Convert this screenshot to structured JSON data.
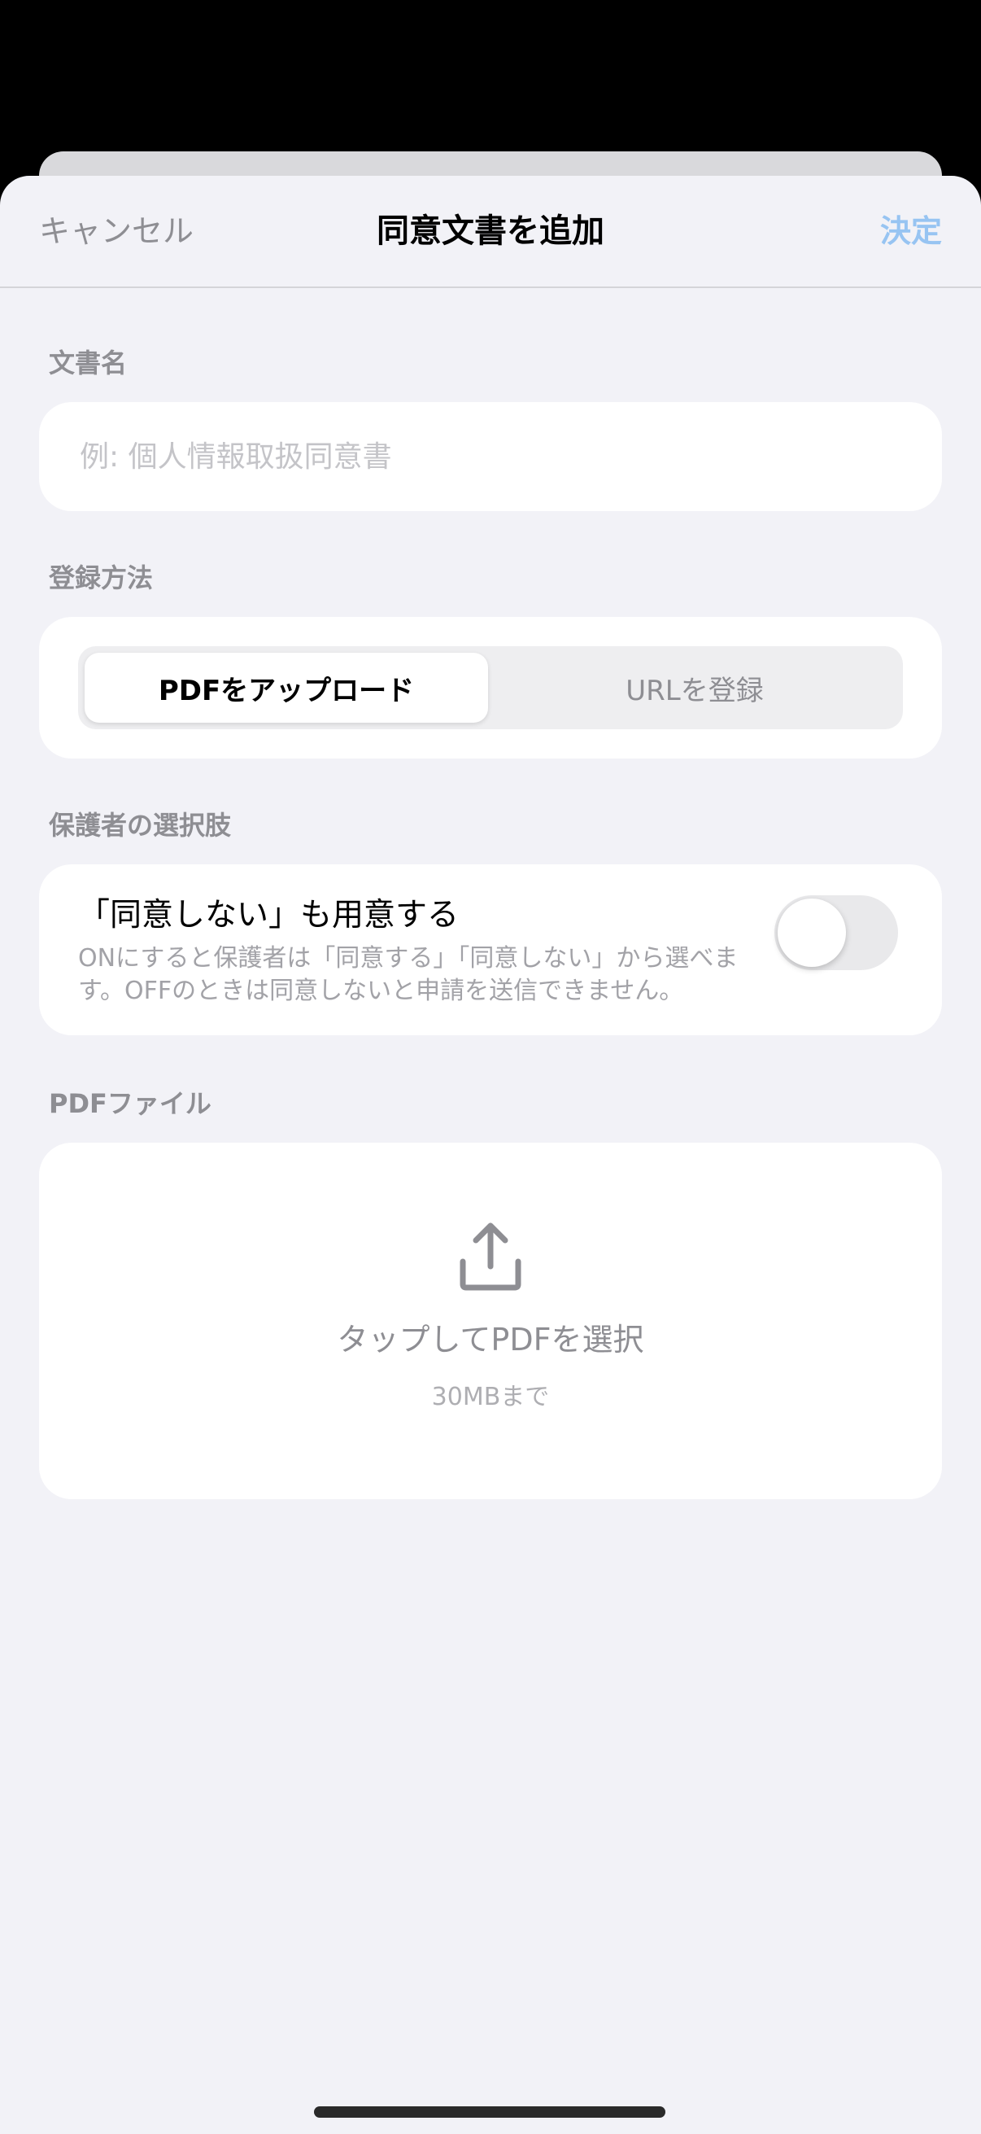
{
  "nav": {
    "cancel_label": "キャンセル",
    "title": "同意文書を追加",
    "done_label": "決定"
  },
  "document_name": {
    "section_label": "文書名",
    "placeholder": "例: 個人情報取扱同意書",
    "value": ""
  },
  "registration_method": {
    "section_label": "登録方法",
    "options": [
      {
        "label": "PDFをアップロード",
        "selected": true
      },
      {
        "label": "URLを登録",
        "selected": false
      }
    ]
  },
  "guardian_choice": {
    "section_label": "保護者の選択肢",
    "toggle_label": "「同意しない」も用意する",
    "description": "ONにすると保護者は「同意する」「同意しない」から選べます。OFFのときは同意しないと申請を送信できません。",
    "toggle_on": false
  },
  "pdf_file": {
    "section_label": "PDFファイル",
    "upload_icon": "upload-icon",
    "tap_label": "タップしてPDFを選択",
    "size_limit": "30MBまで"
  },
  "colors": {
    "accent_disabled": "#97c4f2",
    "background": "#f2f2f7",
    "secondary_text": "#8e8e93"
  }
}
